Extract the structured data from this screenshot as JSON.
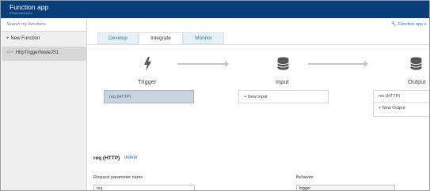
{
  "header": {
    "title": "Function app",
    "subtitle": "NTNeedsSolution"
  },
  "sidebar": {
    "search_placeholder": "Search my functions",
    "new_function_label": "New Function",
    "functions": [
      {
        "label": "HttpTriggerNodeJS1",
        "selected": true
      }
    ]
  },
  "top_link": "Function app s",
  "tabs": [
    {
      "label": "Develop",
      "active": false
    },
    {
      "label": "Integrate",
      "active": true
    },
    {
      "label": "Monitor",
      "active": false
    }
  ],
  "integrate": {
    "trigger": {
      "label": "Trigger",
      "icon": "lightning-bolt-icon",
      "binding": "req (HTTP)"
    },
    "input": {
      "label": "Input",
      "icon": "database-icon",
      "new_label": "+ New Input"
    },
    "output": {
      "label": "Output",
      "icon": "database-icon",
      "binding": "res (HTTP)",
      "new_label": "+ New Output"
    }
  },
  "details": {
    "title": "req (HTTP)",
    "delete_label": "delete",
    "param_label": "Request parameter name",
    "param_value": "req",
    "behavior_label": "Behavior",
    "behavior_value": "trigger"
  },
  "colors": {
    "header": "#0a3e7a",
    "accent": "#2a7ab8",
    "selected_binding": "#c9d4df"
  }
}
